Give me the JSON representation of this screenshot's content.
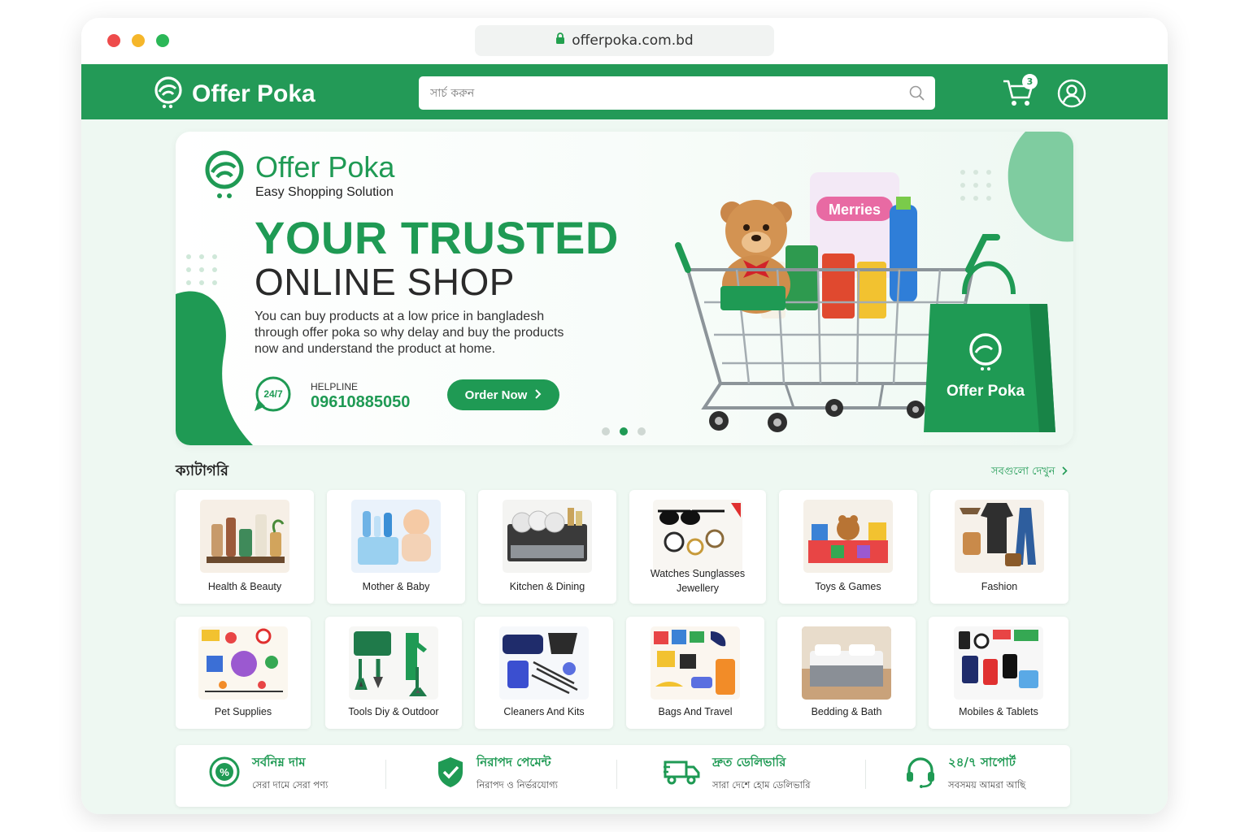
{
  "browser": {
    "url": "offerpoka.com.bd"
  },
  "header": {
    "brand": "Offer Poka",
    "search_placeholder": "সার্চ করুন",
    "cart_count": "3"
  },
  "hero": {
    "brand": "Offer Poka",
    "tagline": "Easy Shopping Solution",
    "headline_1": "YOUR TRUSTED",
    "headline_2": "ONLINE SHOP",
    "description": "You can buy products at a low price in bangladesh through offer poka so why delay and buy the products now and understand the product at home.",
    "helpline_label": "HELPLINE",
    "helpline_number": "09610885050",
    "helpline_icon_text": "24/7",
    "order_button": "Order Now",
    "bag_brand": "Offer Poka",
    "carousel": {
      "count": 3,
      "active_index": 1
    }
  },
  "categories": {
    "title": "ক্যাটাগরি",
    "see_all": "সবগুলো দেখুন",
    "items": [
      {
        "label": "Health & Beauty",
        "icon": "cosmetics-bottles"
      },
      {
        "label": "Mother & Baby",
        "icon": "baby-care"
      },
      {
        "label": "Kitchen & Dining",
        "icon": "dish-rack"
      },
      {
        "label": "Watches Sunglasses Jewellery",
        "icon": "watches-sunglasses"
      },
      {
        "label": "Toys & Games",
        "icon": "toy-blocks"
      },
      {
        "label": "Fashion",
        "icon": "clothing"
      },
      {
        "label": "Pet Supplies",
        "icon": "pet-toys"
      },
      {
        "label": "Tools Diy & Outdoor",
        "icon": "garden-tools"
      },
      {
        "label": "Cleaners And Kits",
        "icon": "cleaning-kit"
      },
      {
        "label": "Bags And Travel",
        "icon": "travel-bags"
      },
      {
        "label": "Bedding & Bath",
        "icon": "bed"
      },
      {
        "label": "Mobiles & Tablets",
        "icon": "phones-accessories"
      }
    ]
  },
  "features": [
    {
      "title": "সর্বনিম্ন দাম",
      "subtitle": "সেরা দামে সেরা পণ্য",
      "icon": "percent-badge-icon"
    },
    {
      "title": "নিরাপদ পেমেন্ট",
      "subtitle": "নিরাপদ ও নির্ভরযোগ্য",
      "icon": "shield-check-icon"
    },
    {
      "title": "দ্রুত ডেলিভারি",
      "subtitle": "সারা দেশে হোম ডেলিভারি",
      "icon": "delivery-truck-icon"
    },
    {
      "title": "২৪/৭ সাপোর্ট",
      "subtitle": "সবসময় আমরা আছি",
      "icon": "headset-icon"
    }
  ],
  "colors": {
    "brand_green": "#239a57",
    "page_bg": "#eef8f2"
  }
}
